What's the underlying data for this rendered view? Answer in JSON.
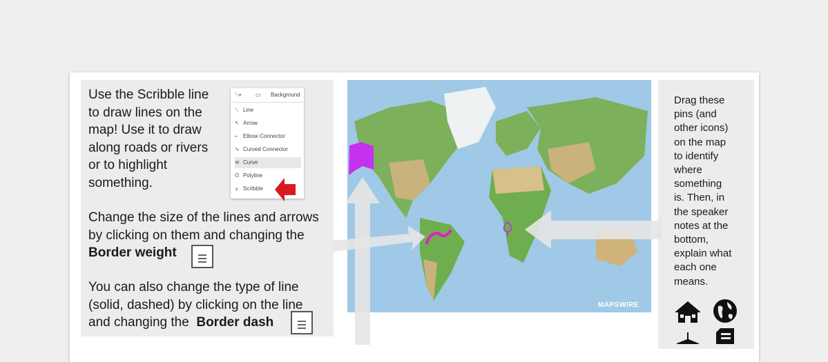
{
  "left_panel": {
    "p1": [
      "Use the Scribble line",
      "to draw lines on the",
      "map! Use it to draw",
      "along roads or rivers",
      "or to highlight",
      "something."
    ],
    "p2_line1": "Change the size of the lines and arrows",
    "p2_line2": "by clicking on them and changing the",
    "p2_bold": "Border weight",
    "p3_line1": "You can also change the type of line",
    "p3_line2": "(solid, dashed) by clicking on the line",
    "p3_line3": "and changing the",
    "p3_bold": "Border dash"
  },
  "menu": {
    "background_label": "Background",
    "items": [
      "Line",
      "Arrow",
      "Elbow Connector",
      "Curved Connector",
      "Curve",
      "Polyline",
      "Scribble"
    ],
    "selected": "Curve"
  },
  "map": {
    "watermark": "MAPSWIRE",
    "colors": {
      "ocean": "#9fc9e6",
      "land_green": "#6fae4e",
      "land_tan": "#c9b27c",
      "ice": "#eef2f2",
      "pin": "#b040d8",
      "scribble": "#e020c8"
    }
  },
  "right_panel": {
    "lines": [
      "Drag these",
      "pins (and",
      "other icons)",
      "on the map",
      "to identify",
      "where",
      "something",
      "is. Then, in",
      "the speaker",
      "notes at the",
      "bottom,",
      "explain what",
      "each one",
      "means."
    ],
    "icons": [
      "house-icon",
      "globe-icon",
      "plane-icon",
      "document-icon"
    ]
  }
}
